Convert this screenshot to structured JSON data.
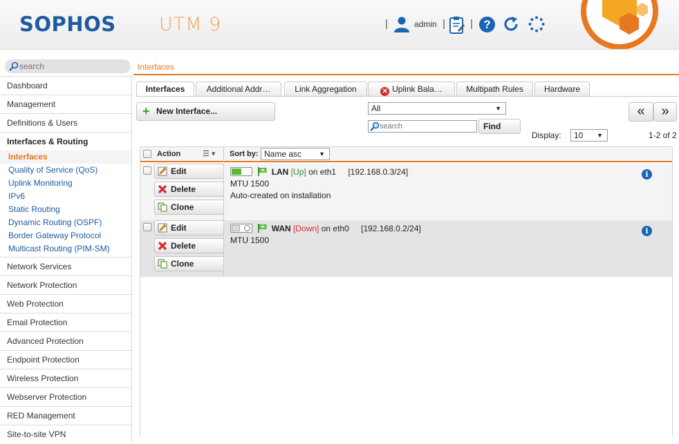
{
  "header": {
    "brand": "SOPHOS",
    "product": "UTM 9",
    "user": "admin",
    "help_glyph": "?"
  },
  "sidebar": {
    "search_placeholder": "search",
    "items_top": [
      {
        "label": "Dashboard"
      },
      {
        "label": "Management"
      },
      {
        "label": "Definitions & Users"
      }
    ],
    "active_section": "Interfaces & Routing",
    "sub_items": [
      {
        "label": "Interfaces",
        "selected": true
      },
      {
        "label": "Quality of Service (QoS)"
      },
      {
        "label": "Uplink Monitoring"
      },
      {
        "label": "IPv6"
      },
      {
        "label": "Static Routing"
      },
      {
        "label": "Dynamic Routing (OSPF)"
      },
      {
        "label": "Border Gateway Protocol"
      },
      {
        "label": "Multicast Routing (PIM-SM)"
      }
    ],
    "items_bottom": [
      {
        "label": "Network Services"
      },
      {
        "label": "Network Protection"
      },
      {
        "label": "Web Protection"
      },
      {
        "label": "Email Protection"
      },
      {
        "label": "Advanced Protection"
      },
      {
        "label": "Endpoint Protection"
      },
      {
        "label": "Wireless Protection"
      },
      {
        "label": "Webserver Protection"
      },
      {
        "label": "RED Management"
      },
      {
        "label": "Site-to-site VPN"
      }
    ]
  },
  "breadcrumb": "Interfaces",
  "tabs": [
    {
      "label": "Interfaces",
      "active": true
    },
    {
      "label": "Additional Addr…"
    },
    {
      "label": "Link Aggregation"
    },
    {
      "label": "Uplink Bala…",
      "error": true
    },
    {
      "label": "Multipath Rules"
    },
    {
      "label": "Hardware"
    }
  ],
  "toolbar": {
    "new_label": "New Interface...",
    "filter_value": "All",
    "search_placeholder": "search",
    "find_label": "Find",
    "prev_glyph": "«",
    "next_glyph": "»",
    "display_label": "Display:",
    "display_value": "10",
    "page_count": "1-2 of 2"
  },
  "list": {
    "action_header": "Action",
    "sortby_label": "Sort by:",
    "sort_value": "Name asc",
    "actions": {
      "edit": "Edit",
      "delete": "Delete",
      "clone": "Clone"
    },
    "rows": [
      {
        "name": "LAN",
        "status": "[Up]",
        "on_text": "on eth1",
        "address": "[192.168.0.3/24]",
        "mtu": "MTU 1500",
        "comment": "Auto-created on installation",
        "enabled": true
      },
      {
        "name": "WAN",
        "status": "[Down]",
        "on_text": "on eth0",
        "address": "[192.168.0.2/24]",
        "mtu": "MTU 1500",
        "comment": "",
        "enabled": false
      }
    ]
  },
  "colors": {
    "accent_orange": "#e87722",
    "brand_blue": "#1d5aa0",
    "status_up": "#2e8b2e",
    "status_down": "#d62b2b"
  }
}
